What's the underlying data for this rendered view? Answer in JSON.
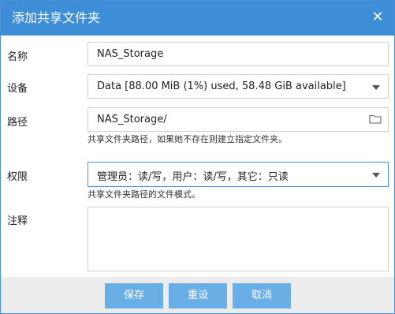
{
  "dialog": {
    "title": "添加共享文件夹"
  },
  "form": {
    "name_label": "名称",
    "name_value": "NAS_Storage",
    "device_label": "设备",
    "device_value": "Data [88.00 MiB (1%) used, 58.48 GiB available]",
    "path_label": "路径",
    "path_value": "NAS_Storage/",
    "path_hint": "共享文件夹路径，如果她不存在则建立指定文件夹。",
    "perm_label": "权限",
    "perm_value": "管理员：读/写，用户：读/写，其它：只读",
    "perm_hint": "共享文件夹路径的文件模式。",
    "comment_label": "注释",
    "comment_value": ""
  },
  "buttons": {
    "save": "保存",
    "reset": "重设",
    "cancel": "取消"
  },
  "colors": {
    "titlebar": "#3d8ed6",
    "button": "#6aaee7",
    "active_border": "#4a8fd3"
  }
}
